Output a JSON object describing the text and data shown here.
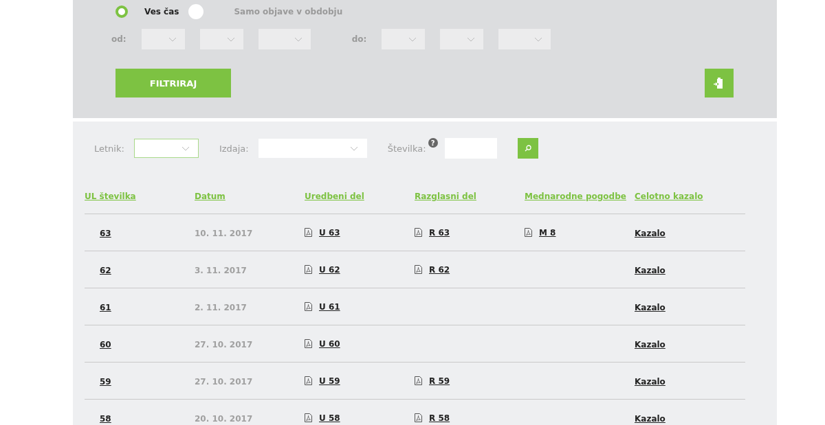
{
  "period": {
    "options": [
      {
        "label": "Ves čas",
        "selected": true
      },
      {
        "label": "Samo objave v obdobju",
        "selected": false
      }
    ]
  },
  "range": [
    {
      "label": "od:"
    },
    {
      "label": "do:"
    }
  ],
  "filter_button": "FILTRIRAJ",
  "search": {
    "fields": [
      {
        "label": "Letnik:",
        "kind": "select",
        "focused": true
      },
      {
        "label": "Izdaja:",
        "kind": "select",
        "focused": false
      },
      {
        "label": "Številka:",
        "kind": "input",
        "help": "?",
        "focused": false
      }
    ]
  },
  "columns": [
    "UL številka",
    "Datum",
    "Uredbeni del",
    "Razglasni del",
    "Mednarodne pogodbe",
    "Celotno kazalo"
  ],
  "rows": [
    {
      "number": "63",
      "date": "10. 11. 2017",
      "uredbeni": "U 63",
      "razglasni": "R 63",
      "mednarodne": "M 8",
      "kazalo": "Kazalo"
    },
    {
      "number": "62",
      "date": "3. 11. 2017",
      "uredbeni": "U 62",
      "razglasni": "R 62",
      "kazalo": "Kazalo"
    },
    {
      "number": "61",
      "date": "2. 11. 2017",
      "uredbeni": "U 61",
      "kazalo": "Kazalo"
    },
    {
      "number": "60",
      "date": "27. 10. 2017",
      "uredbeni": "U 60",
      "kazalo": "Kazalo"
    },
    {
      "number": "59",
      "date": "27. 10. 2017",
      "uredbeni": "U 59",
      "razglasni": "R 59",
      "kazalo": "Kazalo"
    },
    {
      "number": "58",
      "date": "20. 10. 2017",
      "uredbeni": "U 58",
      "razglasni": "R 58",
      "kazalo": "Kazalo"
    }
  ]
}
